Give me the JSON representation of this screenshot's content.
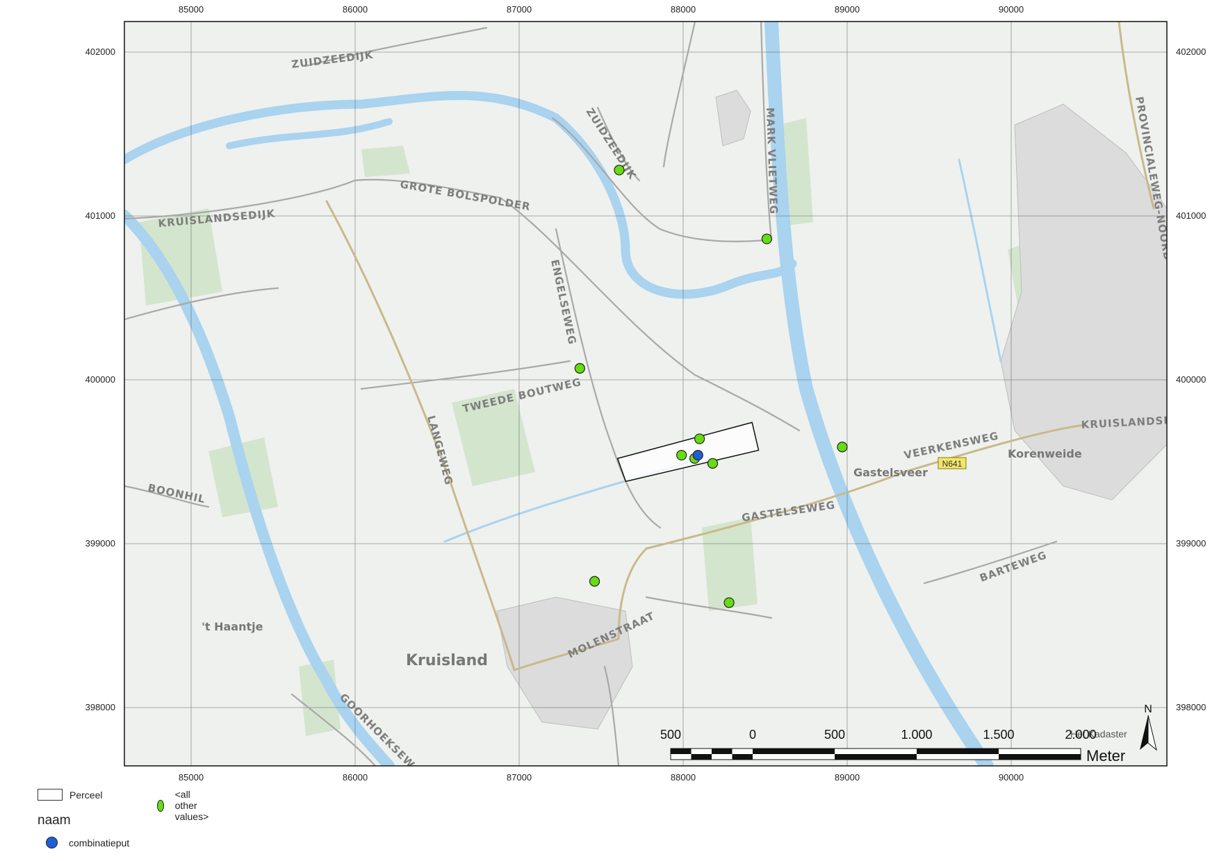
{
  "map": {
    "x_ticks": [
      "85000",
      "86000",
      "87000",
      "88000",
      "89000",
      "90000"
    ],
    "y_ticks": [
      "402000",
      "401000",
      "400000",
      "399000",
      "398000"
    ],
    "road_labels": {
      "zuidzeedijk_1": "ZUIDZEEDIJK",
      "zuidzeedijk_2": "ZUIDZEEDIJK",
      "kruislandsedijk": "KRUISLANDSEDIJK",
      "grote_bolspolder": "GROTE BOLSPOLDER",
      "mark_vlietweg": "MARK VLIETWEG",
      "engelseweg": "ENGELSEWEG",
      "tweede_boutweg": "TWEEDE BOUTWEG",
      "langeweg": "LANGEWEG",
      "boonhil": "BOONHIL",
      "gastelseweg": "GASTELSEWEG",
      "veerkensweg": "VEERKENSWEG",
      "molenstraat": "MOLENSTRAAT",
      "barteweg": "BARTEWEG",
      "goorhoekse": "GOORHOEKSEW",
      "provincialeweg": "PROVINCIALEWEG-NOORD",
      "kruislandse_right": "KRUISLANDSEW"
    },
    "place_labels": {
      "kruisland": "Kruisland",
      "t_haantje": "'t Haantje",
      "gastelsveer": "Gastelsveer",
      "korenweide": "Korenweide",
      "road_shield": "N641"
    },
    "attribution": "Het Kadaster",
    "north_label": "N",
    "scale_bar": {
      "labels": [
        "500",
        "0",
        "500",
        "1.000",
        "1.500",
        "2.000"
      ],
      "unit": "Meter"
    },
    "points_other": [
      {
        "x": 87610,
        "y": 401280
      },
      {
        "x": 88510,
        "y": 400860
      },
      {
        "x": 87370,
        "y": 400070
      },
      {
        "x": 88100,
        "y": 399640
      },
      {
        "x": 87990,
        "y": 399540
      },
      {
        "x": 88070,
        "y": 399520
      },
      {
        "x": 88180,
        "y": 399490
      },
      {
        "x": 88970,
        "y": 399590
      },
      {
        "x": 87460,
        "y": 398770
      },
      {
        "x": 88280,
        "y": 398640
      }
    ],
    "points_combinatieput": [
      {
        "x": 88090,
        "y": 399540
      }
    ],
    "perceel": [
      {
        "x": 87600,
        "y": 399520
      },
      {
        "x": 88420,
        "y": 399740
      },
      {
        "x": 88460,
        "y": 399570
      },
      {
        "x": 87650,
        "y": 399380
      }
    ],
    "colors": {
      "other_values": "#66dd11",
      "combinatieput": "#1f5fd6",
      "water": "#a9d3ef",
      "land": "#eef1ee",
      "field_green": "#cfe3c8"
    }
  },
  "legend": {
    "perceel_label": "Perceel",
    "other_values_label": "<all other values>",
    "naam_title": "naam",
    "combinatieput_label": "combinatieput"
  }
}
